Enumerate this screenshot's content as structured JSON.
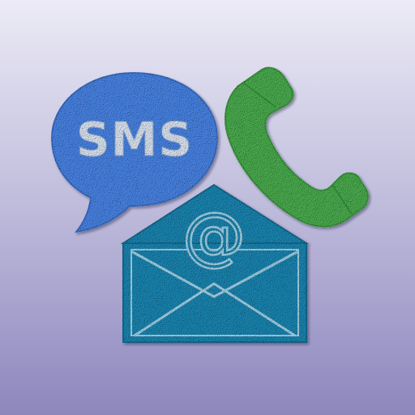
{
  "icon": {
    "sms_label": "SMS",
    "at_symbol": "@",
    "elements": [
      "sms-bubble-icon",
      "phone-handset-icon",
      "email-envelope-icon"
    ]
  },
  "colors": {
    "background_top": "#ecebf6",
    "background_bottom": "#8d87bd",
    "sms_bubble": "#4a86e8",
    "sms_text": "#dfe9f6",
    "phone": "#4caf50",
    "envelope": "#1b88b4",
    "envelope_lines": "#a8d6ea"
  }
}
